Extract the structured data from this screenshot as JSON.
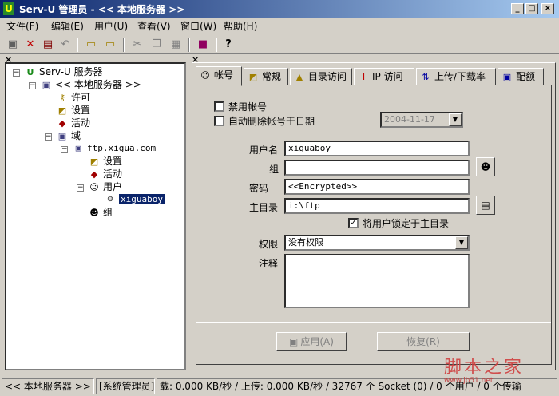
{
  "window": {
    "title": "Serv-U 管理员 - << 本地服务器 >>",
    "app_icon": "U"
  },
  "menu": [
    "文件(F)",
    "编辑(E)",
    "用户(U)",
    "查看(V)",
    "窗口(W)",
    "帮助(H)"
  ],
  "tree": {
    "root": "Serv-U 服务器",
    "server": "<< 本地服务器 >>",
    "license": "许可",
    "settings": "设置",
    "activity": "活动",
    "domains": "域",
    "domain": "ftp.xigua.com",
    "domain_settings": "设置",
    "domain_activity": "活动",
    "users": "用户",
    "user": "xiguaboy",
    "groups": "组"
  },
  "tabs": [
    "帐号",
    "常规",
    "目录访问",
    "IP 访问",
    "上传/下载率",
    "配额"
  ],
  "account": {
    "disable_account_label": "禁用帐号",
    "disable_account_checked": false,
    "auto_delete_label": "自动删除帐号于日期",
    "auto_delete_checked": false,
    "auto_delete_date": "2004-11-17",
    "username_label": "用户名",
    "username": "xiguaboy",
    "group_label": "组",
    "group": "",
    "password_label": "密码",
    "password": "<<Encrypted>>",
    "homedir_label": "主目录",
    "homedir": "i:\\ftp",
    "lock_home_label": "将用户锁定于主目录",
    "lock_home_checked": true,
    "privilege_label": "权限",
    "privilege": "没有权限",
    "notes_label": "注释",
    "notes": ""
  },
  "buttons": {
    "apply": "应用(A)",
    "revert": "恢复(R)"
  },
  "status": {
    "server": "<< 本地服务器 >>",
    "role": "[系统管理员]",
    "transfer": "载: 0.000 KB/秒 / 上传: 0.000 KB/秒 / 32767 个 Socket (0) / 0 个用户 / 0 个传输"
  },
  "watermark": {
    "text": "脚本之家",
    "url": "www.jb51.net"
  },
  "colors": {
    "titlebar_start": "#0a246a",
    "titlebar_end": "#a6caf0",
    "face": "#d4d0c8",
    "selection": "#0a246a",
    "watermark": "#d04040"
  }
}
